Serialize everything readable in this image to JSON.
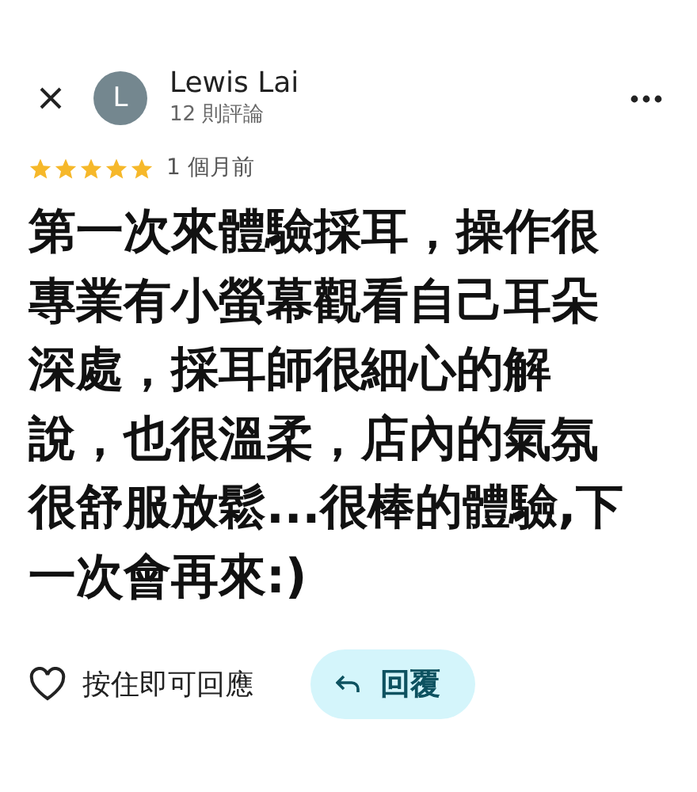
{
  "reviewer": {
    "initial": "L",
    "name": "Lewis Lai",
    "review_count": "12 則評論"
  },
  "rating": {
    "stars": 5,
    "time": "1 個月前"
  },
  "review_text": "第一次來體驗採耳，操作很專業有小螢幕觀看自己耳朵深處，採耳師很細心的解說，也很溫柔，店內的氣氛很舒服放鬆...很棒的體驗,下一次會再來:)",
  "actions": {
    "like_label": "按住即可回應",
    "reply_label": "回覆"
  }
}
